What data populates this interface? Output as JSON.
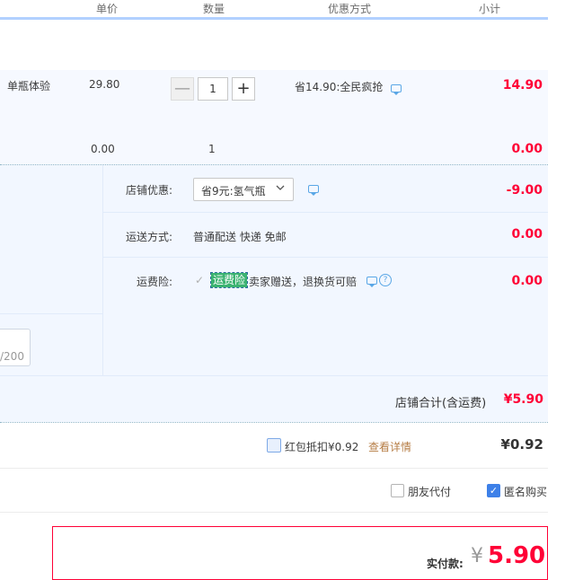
{
  "header": {
    "col_unit_price": "单价",
    "col_quantity": "数量",
    "col_discount": "优惠方式",
    "col_subtotal": "小计"
  },
  "item1": {
    "name": "单瓶体验",
    "unit_price": "29.80",
    "quantity": "1",
    "minus": "—",
    "plus": "+",
    "discount": "省14.90:全民疯抢",
    "subtotal": "14.90"
  },
  "item2": {
    "unit_price": "0.00",
    "quantity": "1",
    "subtotal": "0.00"
  },
  "shop": {
    "coupon_label": "店铺优惠:",
    "coupon_selected": "省9元:氢气瓶",
    "coupon_amount": "-9.00",
    "shipping_label": "运送方式:",
    "shipping_value": "普通配送 快递 免邮",
    "shipping_amount": "0.00",
    "insurance_label": "运费险:",
    "insurance_tag": "运费险",
    "insurance_desc": "卖家赠送，退换货可赔",
    "insurance_amount": "0.00",
    "note_counter": "/200",
    "total_label": "店铺合计(含运费)",
    "total_value": "¥5.90"
  },
  "redpacket": {
    "label": "红包抵扣¥0.92",
    "link": "查看详情",
    "amount": "¥0.92"
  },
  "options": {
    "friend_pay": "朋友代付",
    "anonymous": "匿名购买",
    "anonymous_checked": true
  },
  "payment": {
    "label": "实付款:",
    "currency": "¥",
    "amount": "5.90"
  }
}
